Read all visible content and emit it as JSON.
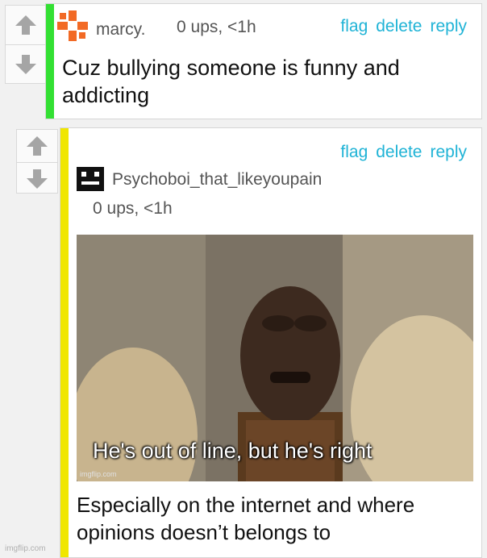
{
  "comments": [
    {
      "username": "marcy.",
      "meta": "0 ups, <1h",
      "actions": {
        "flag": "flag",
        "delete": "delete",
        "reply": "reply"
      },
      "body_line1": "Cuz bullying someone is funny and",
      "body_line2": "addicting",
      "accent_color": "#33e033",
      "avatar_color": "#f26a25"
    },
    {
      "username": "Psychoboi_that_likeyoupain",
      "meta": "0 ups, <1h",
      "actions": {
        "flag": "flag",
        "delete": "delete",
        "reply": "reply"
      },
      "image_caption": "He's out of line, but he's right",
      "image_watermark": "imgflip.com",
      "body_line1": "Especially on the internet and where",
      "body_line2": "opinions doesn’t belongs to",
      "accent_color": "#f0e600",
      "avatar_color": "#111111"
    }
  ],
  "page_watermark": "imgflip.com",
  "icons": {
    "upvote": "arrow-up-icon",
    "downvote": "arrow-down-icon"
  }
}
